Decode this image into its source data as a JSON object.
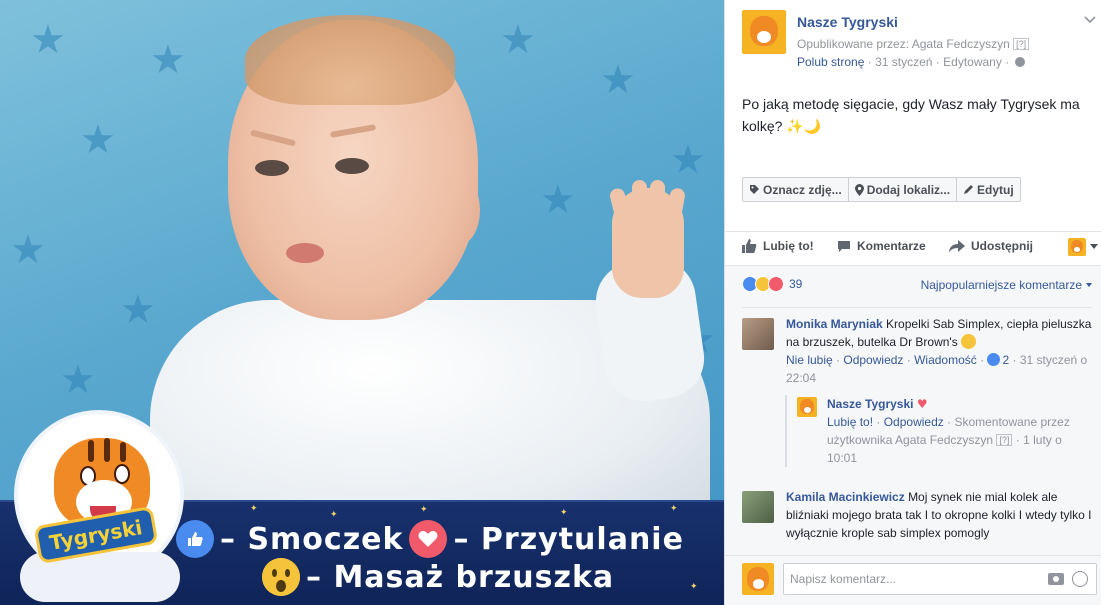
{
  "photo": {
    "banner": {
      "line1_a": "– Smoczek",
      "line1_b": "– Przytulanie",
      "line2": "– Masaż brzuszka"
    },
    "logo_text": "Tygryski"
  },
  "post": {
    "page_name": "Nasze Tygryski",
    "published_by_label": "Opublikowane przez:",
    "published_by_name": "Agata Fedczyszyn",
    "q_badge": "[?]",
    "like_page": "Polub stronę",
    "date": "31 styczeń",
    "edited": "Edytowany",
    "text": "Po jaką metodę sięgacie, gdy Wasz mały Tygrysek ma kolkę?",
    "text_emoji": "✨🌙"
  },
  "photo_tools": {
    "tag": "Oznacz zdję...",
    "location": "Dodaj lokaliz...",
    "edit": "Edytuj"
  },
  "actions": {
    "like": "Lubię to!",
    "comments": "Komentarze",
    "share": "Udostępnij"
  },
  "reactions": {
    "count": "39",
    "sort": "Najpopularniejsze komentarze"
  },
  "comments": [
    {
      "author": "Monika Maryniak",
      "text": "Kropelki Sab Simplex, ciepła pieluszka na brzuszek, butelka Dr Brown's",
      "unlike": "Nie lubię",
      "reply": "Odpowiedz",
      "message": "Wiadomość",
      "likes": "2",
      "time": "31 styczeń o 22:04"
    },
    {
      "author": "Kamila Macinkiewicz",
      "text": "Moj synek nie mial kolek ale bliźniaki mojego brata tak I to okropne kolki I wtedy tylko I wyłącznie krople sab simplex pomogly"
    }
  ],
  "reply": {
    "author": "Nasze Tygryski",
    "heart": "♥",
    "like": "Lubię to!",
    "reply": "Odpowiedz",
    "commented_by": "Skomentowane przez użytkownika Agata Fedczyszyn",
    "q_badge": "[?]",
    "time": "1 luty o 10:01"
  },
  "composer": {
    "placeholder": "Napisz komentarz..."
  },
  "colors": {
    "link": "#365899",
    "muted": "#90949c",
    "like_blue": "#4a8bf0",
    "love_red": "#f05a6b",
    "wow_yellow": "#f6c43a",
    "banner_navy": "#18316d",
    "brand_orange": "#f5b323"
  },
  "icons": [
    "tag-icon",
    "location-pin-icon",
    "pencil-icon",
    "thumbs-up-icon",
    "comment-icon",
    "share-arrow-icon",
    "camera-icon",
    "emoji-icon",
    "globe-icon",
    "chevron-down-icon"
  ]
}
